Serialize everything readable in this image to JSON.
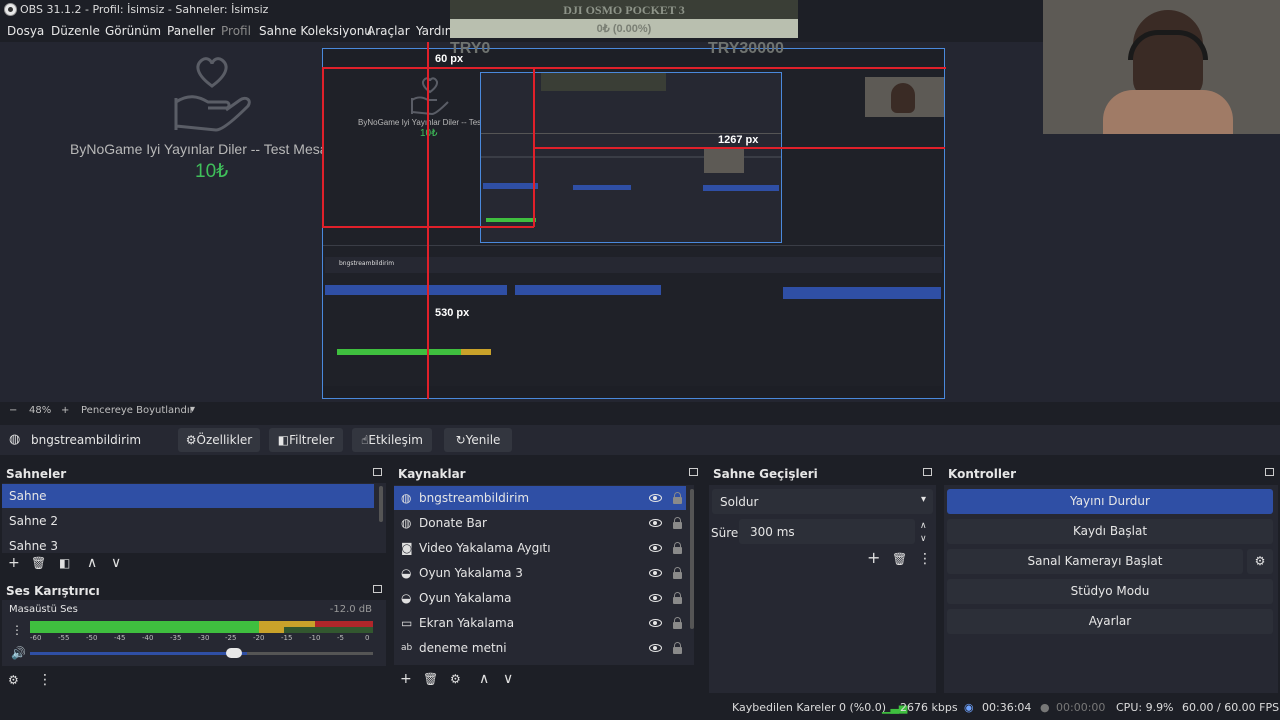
{
  "window": {
    "title": "OBS 31.1.2 - Profil: İsimsiz - Sahneler: İsimsiz"
  },
  "menu": [
    "Dosya",
    "Düzenle",
    "Görünüm",
    "Paneller",
    "Profil",
    "Sahne Koleksiyonu",
    "Araçlar",
    "Yardım"
  ],
  "overlay": {
    "banner_title": "DJI OSMO POCKET 3",
    "banner_progress": "0₺ (0.00%)",
    "progress_fraction": 0.0,
    "try_left": "TRY0",
    "try_right": "TRY30000"
  },
  "preview": {
    "message": "ByNoGame Iyi Yayınlar Diler -- Test Mesajı --",
    "amount": "10₺",
    "measure_top": "60 px",
    "measure_right": "1267 px",
    "measure_bottom": "530 px",
    "measure_inner_right": "1267 px"
  },
  "zoom": {
    "minus": "−",
    "value": "48%",
    "plus": "+",
    "mode": "Pencereye Boyutlandır"
  },
  "source_toolbar": {
    "source_name": "bngstreambildirim",
    "properties": "Özellikler",
    "filters": "Filtreler",
    "interact": "Etkileşim",
    "refresh": "Yenile"
  },
  "scenes": {
    "title": "Sahneler",
    "items": [
      "Sahne",
      "Sahne 2",
      "Sahne 3"
    ]
  },
  "sources": {
    "title": "Kaynaklar",
    "items": [
      {
        "name": "bngstreambildirim",
        "icon": "globe-icon"
      },
      {
        "name": "Donate Bar",
        "icon": "globe-icon"
      },
      {
        "name": "Video Yakalama Aygıtı",
        "icon": "camera-icon"
      },
      {
        "name": "Oyun Yakalama 3",
        "icon": "gamepad-icon"
      },
      {
        "name": "Oyun Yakalama",
        "icon": "gamepad-icon"
      },
      {
        "name": "Ekran Yakalama",
        "icon": "monitor-icon"
      },
      {
        "name": "deneme metni",
        "icon": "text-icon"
      }
    ]
  },
  "transitions": {
    "title": "Sahne Geçişleri",
    "selected": "Soldur",
    "duration_label": "Süre",
    "duration_value": "300 ms"
  },
  "controls": {
    "title": "Kontroller",
    "buttons": [
      "Yayını Durdur",
      "Kaydı Başlat",
      "Sanal Kamerayı Başlat",
      "Stüdyo Modu",
      "Ayarlar"
    ]
  },
  "mixer": {
    "title": "Ses Karıştırıcı",
    "track": "Masaüstü Ses",
    "db": "-12.0 dB",
    "ticks": [
      "-60",
      "-55",
      "-50",
      "-45",
      "-40",
      "-35",
      "-30",
      "-25",
      "-20",
      "-15",
      "-10",
      "-5",
      "0"
    ],
    "volume_fraction": 0.88,
    "level_fraction": 0.74
  },
  "status": {
    "dropped": "Kaybedilen Kareler 0 (%0.0)",
    "bitrate": "2676 kbps",
    "stream_time": "00:36:04",
    "rec_time": "00:00:00",
    "cpu": "CPU: 9.9%",
    "fps": "60.00 / 60.00 FPS"
  },
  "colors": {
    "accent": "#2f4fa5",
    "guide": "#e0202a",
    "amount": "#3fbf5a",
    "meter_green": "#3fbf3f",
    "meter_yellow": "#c9a22a",
    "meter_red": "#b0262a"
  }
}
